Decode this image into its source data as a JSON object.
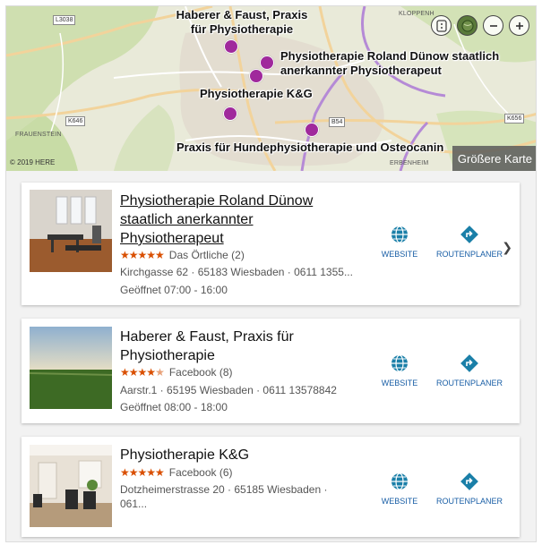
{
  "map": {
    "labels": {
      "haberer": "Haberer & Faust, Praxis\nfür Physiotherapie",
      "dunow": "Physiotherapie Roland Dünow staatlich\nanerkannter Physiotherapeut",
      "kg": "Physiotherapie K&G",
      "hunde": "Praxis für Hundephysiotherapie und Osteocanin"
    },
    "places": {
      "frauenstein": "FRAUENSTEIN",
      "kloppenheim": "KLOPPENH",
      "erbenheim": "ERBENHEIM"
    },
    "roads": {
      "l3038": "L3038",
      "k646": "K646",
      "b54": "B54",
      "k656": "K656"
    },
    "copyright": "© 2019 HERE",
    "bigger_map": "Größere Karte"
  },
  "results": [
    {
      "title": "Physiotherapie Roland Dünow staatlich anerkannter Physiotherapeut",
      "stars": "★★★★★",
      "rating_source": "Das Örtliche (2)",
      "address": "Kirchgasse 62 · 65183 Wiesbaden · 0611 1355...",
      "hours": "Geöffnet 07:00 - 16:00",
      "website": "WEBSITE",
      "route": "ROUTENPLANER"
    },
    {
      "title": "Haberer & Faust, Praxis für Physiotherapie",
      "stars": "★★★★★",
      "rating_value": 4.5,
      "rating_source": "Facebook (8)",
      "address": "Aarstr.1 · 65195 Wiesbaden · 0611 13578842",
      "hours": "Geöffnet 08:00 - 18:00",
      "website": "WEBSITE",
      "route": "ROUTENPLANER"
    },
    {
      "title": "Physiotherapie K&G",
      "stars": "★★★★★",
      "rating_source": "Facebook (6)",
      "address": "Dotzheimerstrasse 20 · 65185 Wiesbaden · 061...",
      "website": "WEBSITE",
      "route": "ROUTENPLANER"
    }
  ],
  "colors": {
    "pin": "#a0299c",
    "stars": "#d94f00",
    "link": "#1a5fa6",
    "action_icon": "#1a7fa8"
  },
  "icons": {
    "website": "globe-icon",
    "route": "route-arrow-icon",
    "next": "chevron-right-icon"
  }
}
